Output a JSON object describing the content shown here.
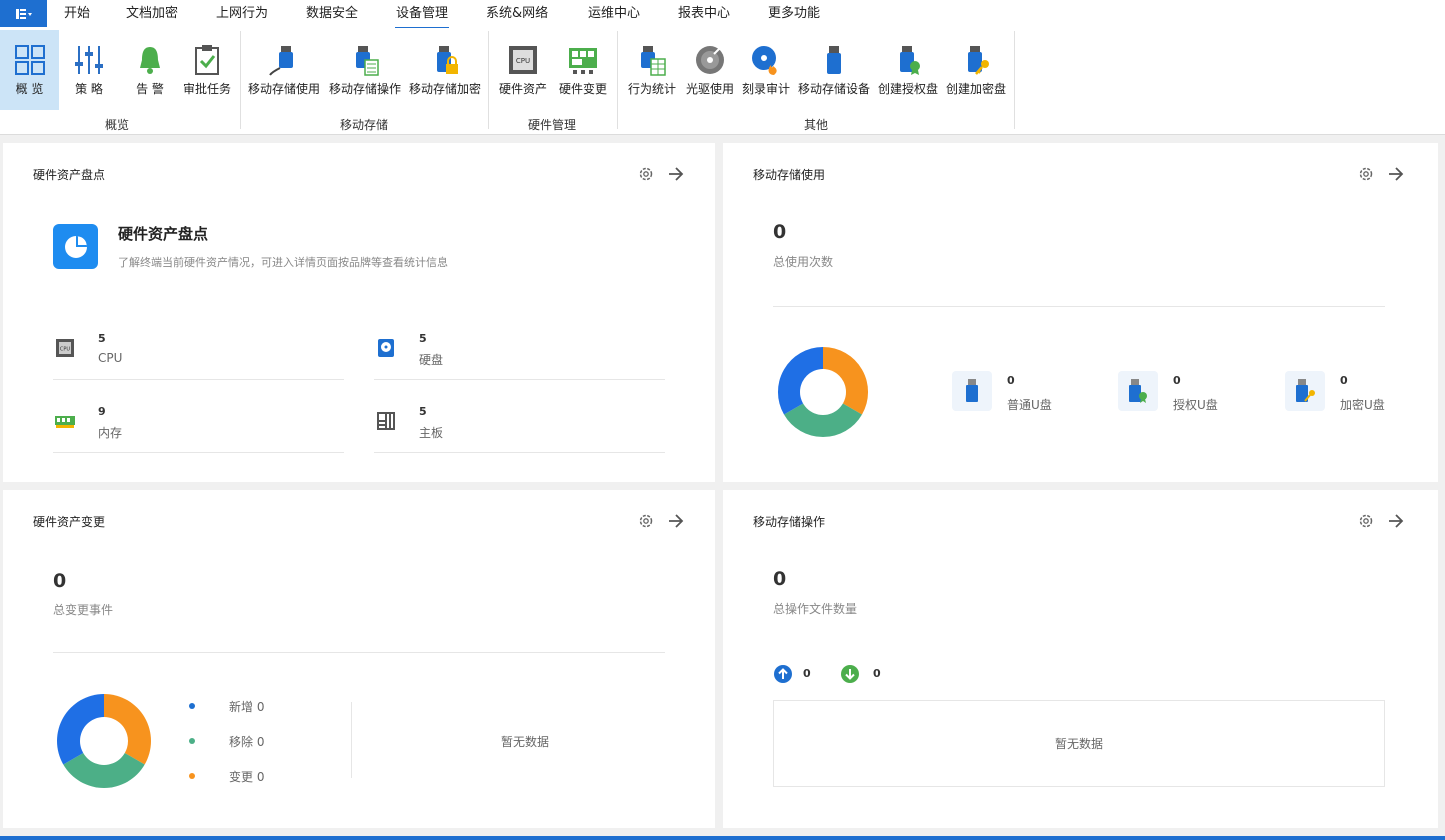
{
  "menu": {
    "tabs": [
      {
        "label": "开始"
      },
      {
        "label": "文档加密"
      },
      {
        "label": "上网行为"
      },
      {
        "label": "数据安全"
      },
      {
        "label": "设备管理"
      },
      {
        "label": "系统&网络"
      },
      {
        "label": "运维中心"
      },
      {
        "label": "报表中心"
      },
      {
        "label": "更多功能"
      }
    ],
    "active_tab": "设备管理"
  },
  "ribbon": {
    "items": [
      {
        "label": "概 览",
        "icon": "grid-icon",
        "selected": true
      },
      {
        "label": "策 略",
        "icon": "sliders-icon"
      },
      {
        "label": "告 警",
        "icon": "bell-icon"
      },
      {
        "label": "审批任务",
        "icon": "clipboard-check-icon"
      },
      {
        "label": "移动存储使用",
        "icon": "usb-plug-icon"
      },
      {
        "label": "移动存储操作",
        "icon": "usb-doc-icon"
      },
      {
        "label": "移动存储加密",
        "icon": "usb-lock-icon"
      },
      {
        "label": "硬件资产",
        "icon": "cpu-icon"
      },
      {
        "label": "硬件变更",
        "icon": "board-change-icon"
      },
      {
        "label": "行为统计",
        "icon": "usb-table-icon"
      },
      {
        "label": "光驱使用",
        "icon": "disc-icon"
      },
      {
        "label": "刻录审计",
        "icon": "disc-fire-icon"
      },
      {
        "label": "移动存储设备",
        "icon": "usb-drive-icon"
      },
      {
        "label": "创建授权盘",
        "icon": "usb-cert-icon"
      },
      {
        "label": "创建加密盘",
        "icon": "usb-key-icon"
      }
    ],
    "groups": [
      {
        "label": "概览"
      },
      {
        "label": "移动存储"
      },
      {
        "label": "硬件管理"
      },
      {
        "label": "其他"
      }
    ]
  },
  "cards": {
    "hw_inventory": {
      "title": "硬件资产盘点",
      "hero_title": "硬件资产盘点",
      "hero_desc": "了解终端当前硬件资产情况，可进入详情页面按品牌等查看统计信息",
      "stats": [
        {
          "value": "5",
          "label": "CPU",
          "icon": "cpu-chip-icon"
        },
        {
          "value": "5",
          "label": "硬盘",
          "icon": "hard-disk-icon"
        },
        {
          "value": "9",
          "label": "内存",
          "icon": "memory-icon"
        },
        {
          "value": "5",
          "label": "主板",
          "icon": "motherboard-icon"
        }
      ]
    },
    "usb_usage": {
      "title": "移动存储使用",
      "total": "0",
      "total_label": "总使用次数",
      "types": [
        {
          "value": "0",
          "label": "普通U盘",
          "icon": "usb-normal-icon"
        },
        {
          "value": "0",
          "label": "授权U盘",
          "icon": "usb-authorized-icon"
        },
        {
          "value": "0",
          "label": "加密U盘",
          "icon": "usb-encrypted-icon"
        }
      ]
    },
    "hw_change": {
      "title": "硬件资产变更",
      "total": "0",
      "total_label": "总变更事件",
      "legend": [
        {
          "label": "新增 0",
          "color": "#1e6fd0"
        },
        {
          "label": "移除 0",
          "color": "#4caf87"
        },
        {
          "label": "变更 0",
          "color": "#f7931e"
        }
      ],
      "empty": "暂无数据"
    },
    "usb_ops": {
      "title": "移动存储操作",
      "total": "0",
      "total_label": "总操作文件数量",
      "up_count": "0",
      "down_count": "0",
      "empty": "暂无数据"
    }
  },
  "colors": {
    "accent": "#1e6fd0",
    "orange": "#f7931e",
    "green": "#4caf87",
    "blue": "#1f6fe5"
  }
}
